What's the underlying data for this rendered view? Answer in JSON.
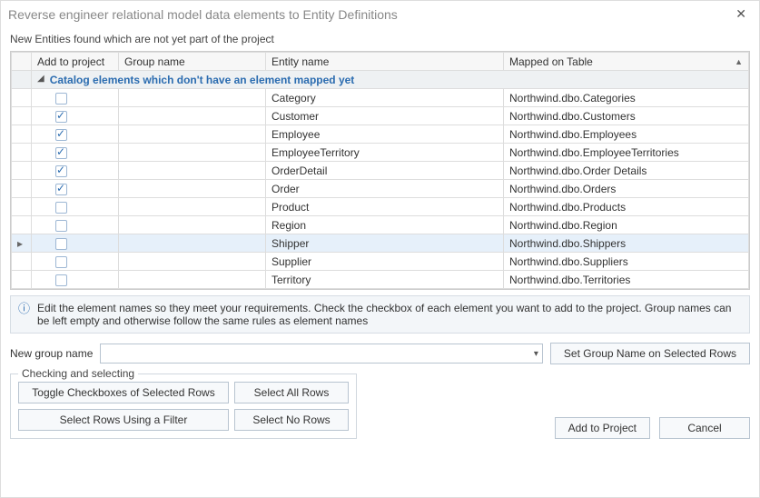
{
  "dialog": {
    "title": "Reverse engineer relational model data elements to Entity Definitions",
    "subtitle": "New Entities found which are not yet part of the project"
  },
  "columns": {
    "add": "Add to project",
    "group": "Group name",
    "entity": "Entity name",
    "mapped": "Mapped on Table"
  },
  "groupHeader": "Catalog elements which don't have an element mapped yet",
  "rows": [
    {
      "checked": false,
      "group": "",
      "entity": "Category",
      "mapped": "Northwind.dbo.Categories",
      "selected": false
    },
    {
      "checked": true,
      "group": "",
      "entity": "Customer",
      "mapped": "Northwind.dbo.Customers",
      "selected": false
    },
    {
      "checked": true,
      "group": "",
      "entity": "Employee",
      "mapped": "Northwind.dbo.Employees",
      "selected": false
    },
    {
      "checked": true,
      "group": "",
      "entity": "EmployeeTerritory",
      "mapped": "Northwind.dbo.EmployeeTerritories",
      "selected": false
    },
    {
      "checked": true,
      "group": "",
      "entity": "OrderDetail",
      "mapped": "Northwind.dbo.Order Details",
      "selected": false
    },
    {
      "checked": true,
      "group": "",
      "entity": "Order",
      "mapped": "Northwind.dbo.Orders",
      "selected": false
    },
    {
      "checked": false,
      "group": "",
      "entity": "Product",
      "mapped": "Northwind.dbo.Products",
      "selected": false
    },
    {
      "checked": false,
      "group": "",
      "entity": "Region",
      "mapped": "Northwind.dbo.Region",
      "selected": false
    },
    {
      "checked": false,
      "group": "",
      "entity": "Shipper",
      "mapped": "Northwind.dbo.Shippers",
      "selected": true
    },
    {
      "checked": false,
      "group": "",
      "entity": "Supplier",
      "mapped": "Northwind.dbo.Suppliers",
      "selected": false
    },
    {
      "checked": false,
      "group": "",
      "entity": "Territory",
      "mapped": "Northwind.dbo.Territories",
      "selected": false
    }
  ],
  "info": "Edit the element names so they meet your requirements. Check the checkbox of each element you want to add to the project. Group names can be left empty and otherwise follow the same rules as element names",
  "form": {
    "newGroupLabel": "New group name",
    "setGroup": "Set Group Name on Selected Rows"
  },
  "checking": {
    "legend": "Checking and selecting",
    "toggle": "Toggle Checkboxes of Selected Rows",
    "selectAll": "Select All Rows",
    "filter": "Select Rows Using a Filter",
    "selectNone": "Select No Rows"
  },
  "footer": {
    "add": "Add to Project",
    "cancel": "Cancel"
  }
}
